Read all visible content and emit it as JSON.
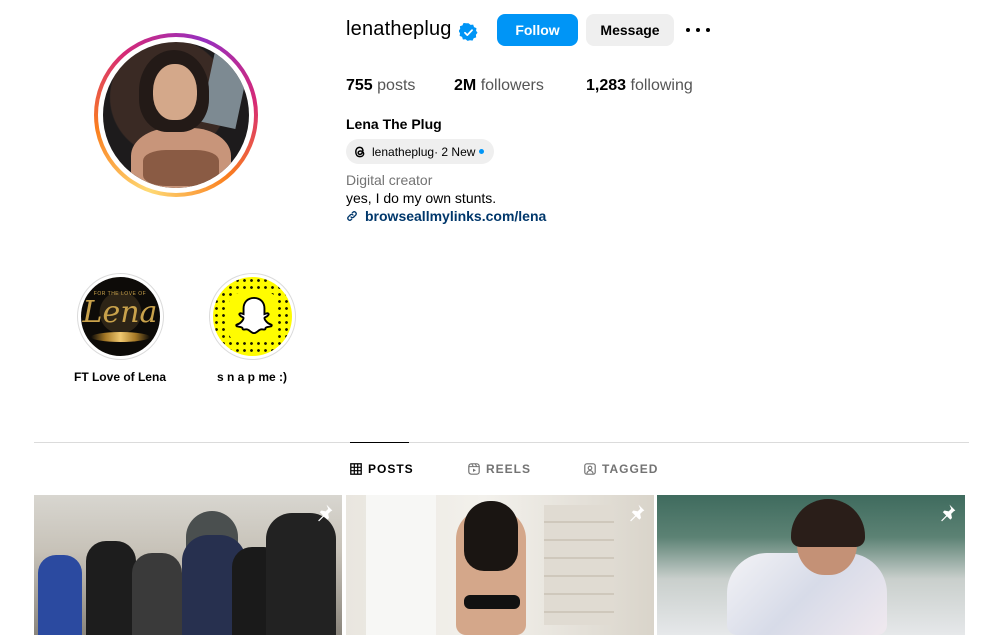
{
  "profile": {
    "username": "lenatheplug",
    "full_name": "Lena The Plug",
    "follow_label": "Follow",
    "message_label": "Message",
    "stats": {
      "posts_count": "755",
      "posts_label": "posts",
      "followers_count": "2M",
      "followers_label": "followers",
      "following_count": "1,283",
      "following_label": "following"
    },
    "threads": {
      "handle": "lenatheplug",
      "new_text": " · 2 New"
    },
    "category": "Digital creator",
    "bio": "yes, I do my own stunts.",
    "link": "browseallmylinks.com/lena"
  },
  "highlights": [
    {
      "label": "FT Love of Lena",
      "cover_text": "Lena",
      "cover_small": "FOR THE LOVE OF"
    },
    {
      "label": "s n a p me :)"
    }
  ],
  "tabs": [
    {
      "label": "POSTS",
      "icon": "grid-icon",
      "active": true
    },
    {
      "label": "REELS",
      "icon": "reels-icon",
      "active": false
    },
    {
      "label": "TAGGED",
      "icon": "tagged-icon",
      "active": false
    }
  ],
  "posts": [
    {
      "pinned": true
    },
    {
      "pinned": true
    },
    {
      "pinned": true
    }
  ],
  "colors": {
    "follow_button": "#0095f6",
    "verified_badge": "#0095f6",
    "link_text": "#00376b",
    "snapchat_yellow": "#fffc00"
  }
}
